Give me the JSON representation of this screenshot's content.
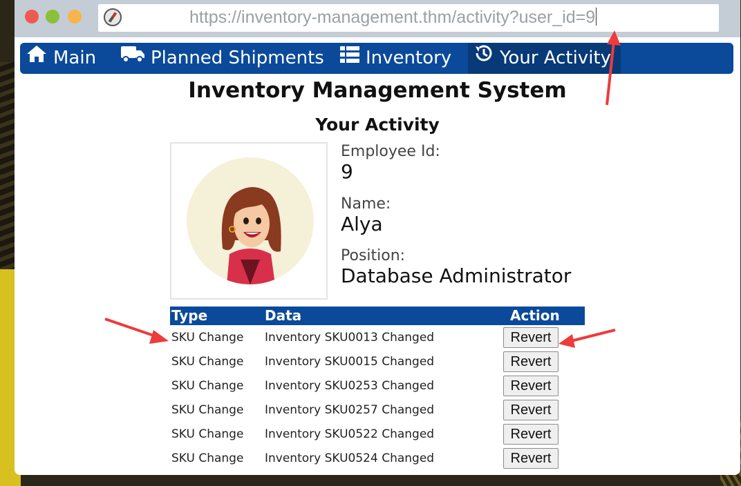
{
  "browser": {
    "url": "https://inventory-management.thm/activity?user_id=9"
  },
  "nav": {
    "items": [
      {
        "label": "Main",
        "icon": "home-icon"
      },
      {
        "label": "Planned Shipments",
        "icon": "truck-icon"
      },
      {
        "label": "Inventory",
        "icon": "list-icon"
      },
      {
        "label": "Your Activity",
        "icon": "history-icon",
        "active": true
      }
    ]
  },
  "page": {
    "title": "Inventory Management System",
    "subtitle": "Your Activity"
  },
  "profile": {
    "employee_id_label": "Employee Id:",
    "employee_id": "9",
    "name_label": "Name:",
    "name": "Alya",
    "position_label": "Position:",
    "position": "Database Administrator"
  },
  "activity_table": {
    "headers": [
      "Type",
      "Data",
      "Action"
    ],
    "rows": [
      {
        "type": "SKU Change",
        "data": "Inventory SKU0013 Changed",
        "action": "Revert"
      },
      {
        "type": "SKU Change",
        "data": "Inventory SKU0015 Changed",
        "action": "Revert"
      },
      {
        "type": "SKU Change",
        "data": "Inventory SKU0253 Changed",
        "action": "Revert"
      },
      {
        "type": "SKU Change",
        "data": "Inventory SKU0257 Changed",
        "action": "Revert"
      },
      {
        "type": "SKU Change",
        "data": "Inventory SKU0522 Changed",
        "action": "Revert"
      },
      {
        "type": "SKU Change",
        "data": "Inventory SKU0524 Changed",
        "action": "Revert"
      }
    ]
  },
  "colors": {
    "nav_bg": "#0b4a9a",
    "nav_active": "#083a78",
    "annotation_arrow": "#ee3b3b"
  }
}
